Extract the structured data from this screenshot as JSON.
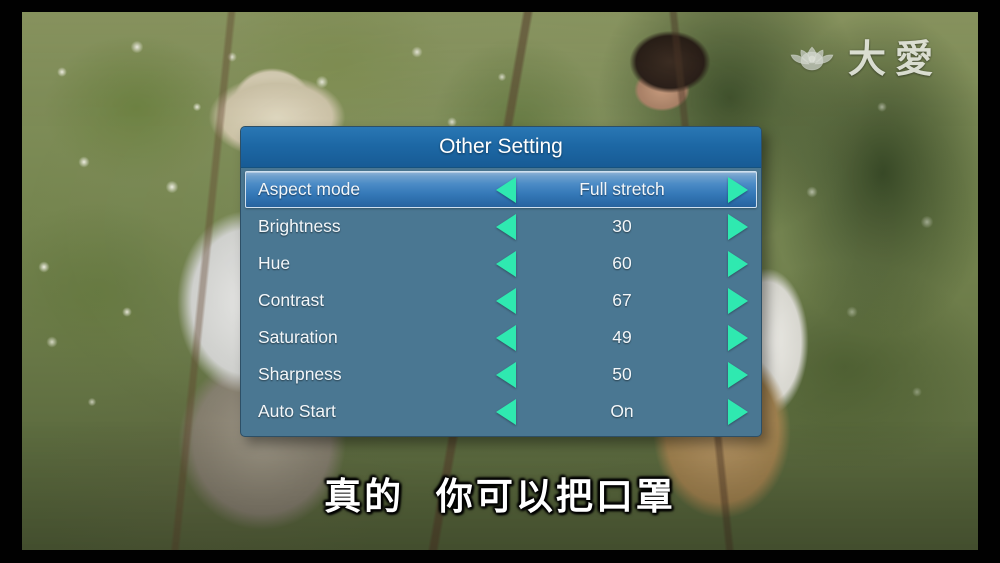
{
  "screen": {
    "letterbox_color": "#010101",
    "video": {
      "description": "cotton field with two people harvesting",
      "watermark": {
        "logo_icon": "lotus-logo-icon",
        "text": "大愛"
      },
      "subtitle": "真的  你可以把口罩"
    }
  },
  "osd": {
    "title": "Other Setting",
    "accent_color": "#2fe9b0",
    "panel_color": "#4a7792",
    "title_bar_color": "#1d68a5",
    "highlight_color": "#3579b8",
    "left_arrow_icon": "triangle-left-icon",
    "right_arrow_icon": "triangle-right-icon",
    "rows": [
      {
        "label": "Aspect mode",
        "value": "Full stretch",
        "selected": true
      },
      {
        "label": "Brightness",
        "value": "30",
        "selected": false
      },
      {
        "label": "Hue",
        "value": "60",
        "selected": false
      },
      {
        "label": "Contrast",
        "value": "67",
        "selected": false
      },
      {
        "label": "Saturation",
        "value": "49",
        "selected": false
      },
      {
        "label": "Sharpness",
        "value": "50",
        "selected": false
      },
      {
        "label": "Auto Start",
        "value": "On",
        "selected": false
      }
    ]
  }
}
